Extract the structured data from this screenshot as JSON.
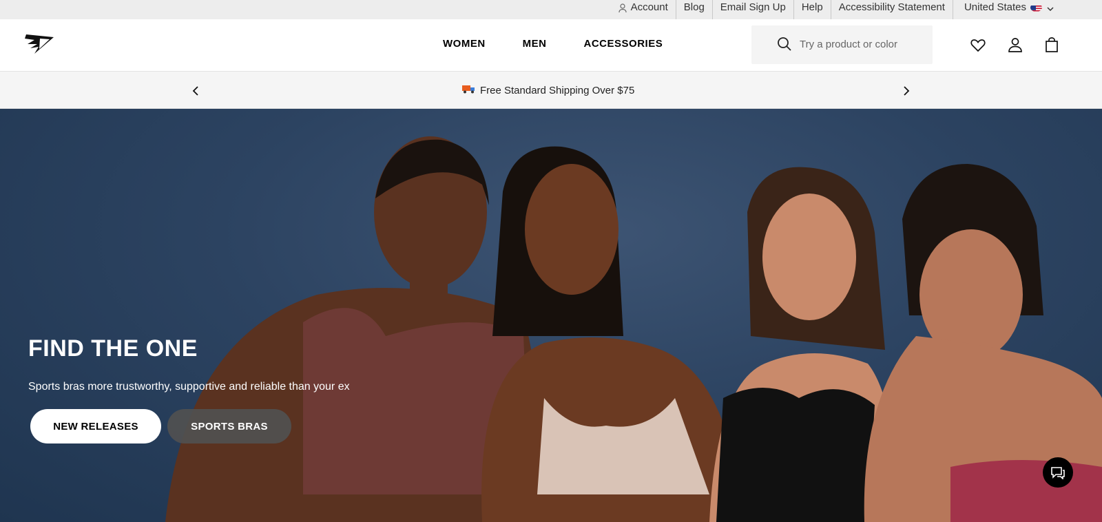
{
  "utility_bar": {
    "links": [
      "Account",
      "Blog",
      "Email Sign Up",
      "Help",
      "Accessibility Statement"
    ],
    "country": "United States"
  },
  "header": {
    "nav": [
      "WOMEN",
      "MEN",
      "ACCESSORIES"
    ],
    "search_placeholder": "Try a product or color"
  },
  "promo": {
    "message": "Free Standard Shipping Over $75"
  },
  "hero": {
    "title": "FIND THE ONE",
    "subtitle": "Sports bras more trustworthy, supportive and reliable than your ex",
    "buttons": [
      "NEW RELEASES",
      "SPORTS BRAS"
    ]
  },
  "colors": {
    "hero_bg": "#2c4361",
    "secondary_button_bg": "#505050"
  }
}
